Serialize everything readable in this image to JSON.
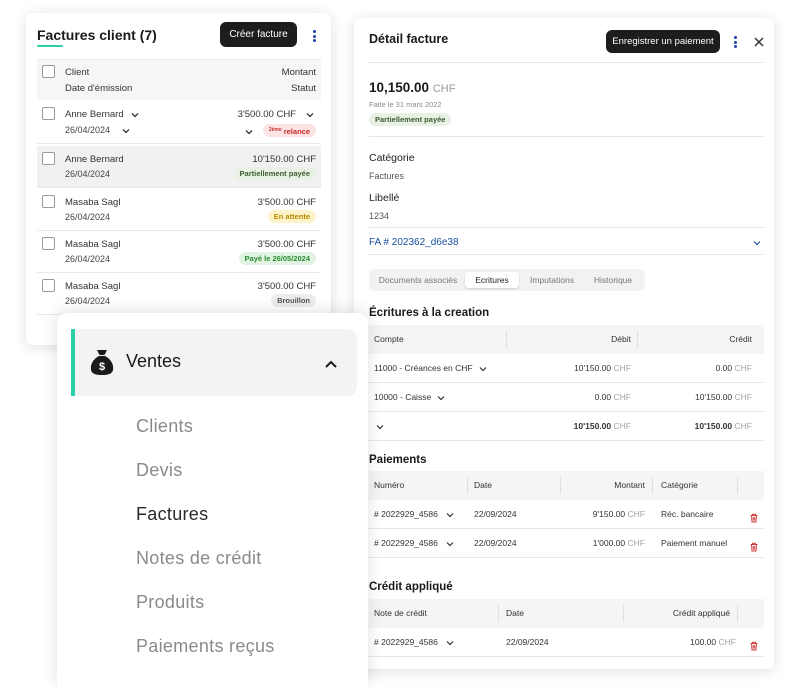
{
  "invoice_list": {
    "title": "Factures client (7)",
    "create_button": "Créer facture",
    "header": {
      "client": "Client",
      "issue_date": "Date d'émission",
      "amount": "Montant",
      "status": "Statut"
    },
    "rows": [
      {
        "client": "Anne Bernard",
        "date": "26/04/2024",
        "amount": "3'500.00 CHF",
        "status_prefix": "2ème",
        "status": "relance",
        "status_color": "#c42b2b"
      },
      {
        "client": "Anne Bernard",
        "date": "26/04/2024",
        "amount": "10'150.00 CHF",
        "status": "Partiellement payée",
        "status_color": "#3c5d30"
      },
      {
        "client": "Masaba Sagl",
        "date": "26/04/2024",
        "amount": "3'500.00 CHF",
        "status": "En attente",
        "status_color": "#b88a00"
      },
      {
        "client": "Masaba Sagl",
        "date": "26/04/2024",
        "amount": "3'500.00 CHF",
        "status": "Payé le 26/05/2024",
        "status_color": "#2a8a34"
      },
      {
        "client": "Masaba Sagl",
        "date": "26/04/2024",
        "amount": "3'500.00 CHF",
        "status": "Brouillon",
        "status_color": "#555555"
      }
    ]
  },
  "invoice_detail": {
    "title": "Détail facture",
    "register_payment_button": "Enregistrer un paiement",
    "amount": "10,150.00",
    "currency": "CHF",
    "issued": "Faite le 31 mars 2022",
    "status": "Partiellement payée",
    "category_label": "Catégorie",
    "category_value": "Factures",
    "libelle_label": "Libellé",
    "libelle_value": "1234",
    "reference_link": "FA # 202362_d6e38",
    "tabs": [
      "Documents associés",
      "Ecritures",
      "Imputations",
      "Historique"
    ],
    "active_tab": "Ecritures",
    "entries": {
      "title": "Écritures à la creation",
      "headers": {
        "account": "Compte",
        "debit": "Débit",
        "credit": "Crédit"
      },
      "rows": [
        {
          "account": "11000 - Créances en CHF",
          "debit": "10'150.00",
          "credit": "0.00"
        },
        {
          "account": "10000 - Caisse",
          "debit": "0.00",
          "credit": "10'150.00"
        }
      ],
      "total": {
        "debit": "10'150.00",
        "credit": "10'150.00"
      }
    },
    "payments": {
      "title": "Paiements",
      "headers": {
        "number": "Numéro",
        "date": "Date",
        "amount": "Montant",
        "category": "Catégorie"
      },
      "rows": [
        {
          "number": "# 2022929_4586",
          "date": "22/09/2024",
          "amount": "9'150.00",
          "category": "Réc. bancaire"
        },
        {
          "number": "# 2022929_4586",
          "date": "22/09/2024",
          "amount": "1'000.00",
          "category": "Paiement manuel"
        }
      ]
    },
    "credits": {
      "title": "Crédit appliqué",
      "headers": {
        "credit_note": "Note de crédit",
        "date": "Date",
        "applied": "Crédit appliqué"
      },
      "rows": [
        {
          "number": "# 2022929_4586",
          "date": "22/09/2024",
          "applied": "100.00"
        }
      ]
    }
  },
  "nav": {
    "section": "Ventes",
    "accent_color": "#2ccfa8",
    "items": [
      "Clients",
      "Devis",
      "Factures",
      "Notes de crédit",
      "Produits",
      "Paiements reçus"
    ],
    "active_item": "Factures"
  }
}
